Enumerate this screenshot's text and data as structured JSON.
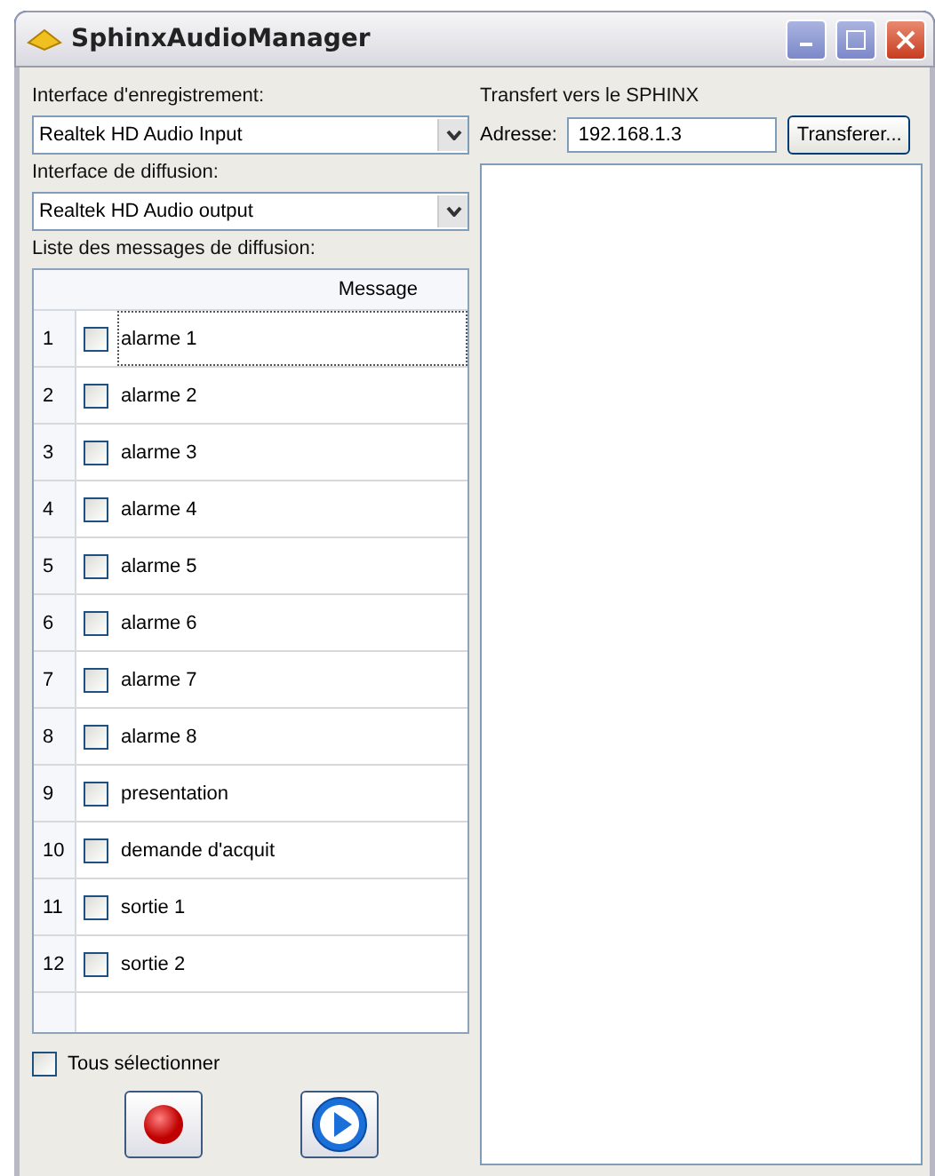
{
  "window": {
    "title": "SphinxAudioManager"
  },
  "recording": {
    "label": "Interface d'enregistrement:",
    "value": "Realtek HD Audio Input"
  },
  "playback": {
    "label": "Interface de diffusion:",
    "value": "Realtek HD Audio output"
  },
  "messages": {
    "label": "Liste des messages de diffusion:",
    "column": "Message",
    "rows": [
      {
        "index": "1",
        "name": "alarme 1",
        "checked": false,
        "focused": true
      },
      {
        "index": "2",
        "name": "alarme 2",
        "checked": false,
        "focused": false
      },
      {
        "index": "3",
        "name": "alarme 3",
        "checked": false,
        "focused": false
      },
      {
        "index": "4",
        "name": "alarme 4",
        "checked": false,
        "focused": false
      },
      {
        "index": "5",
        "name": "alarme 5",
        "checked": false,
        "focused": false
      },
      {
        "index": "6",
        "name": "alarme 6",
        "checked": false,
        "focused": false
      },
      {
        "index": "7",
        "name": "alarme 7",
        "checked": false,
        "focused": false
      },
      {
        "index": "8",
        "name": "alarme 8",
        "checked": false,
        "focused": false
      },
      {
        "index": "9",
        "name": "presentation",
        "checked": false,
        "focused": false
      },
      {
        "index": "10",
        "name": "demande d'acquit",
        "checked": false,
        "focused": false
      },
      {
        "index": "11",
        "name": "sortie 1",
        "checked": false,
        "focused": false
      },
      {
        "index": "12",
        "name": "sortie 2",
        "checked": false,
        "focused": false
      }
    ]
  },
  "select_all": {
    "label": "Tous sélectionner",
    "checked": false
  },
  "transfer": {
    "title": "Transfert vers le SPHINX",
    "address_label": "Adresse:",
    "address": "192.168.1.3",
    "button": "Transferer..."
  }
}
